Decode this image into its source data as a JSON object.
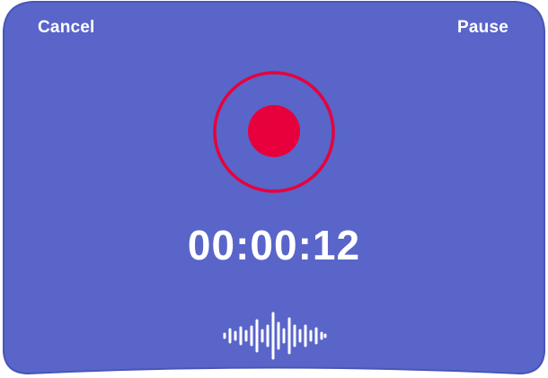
{
  "header": {
    "cancel_label": "Cancel",
    "pause_label": "Pause"
  },
  "recorder": {
    "elapsed_time": "00:00:12",
    "record_icon": "record-icon",
    "waveform_icon": "waveform-icon"
  },
  "colors": {
    "panel_background": "#5965C8",
    "panel_border": "#4A55B8",
    "record_accent": "#E8003C",
    "text": "#FFFFFF"
  }
}
